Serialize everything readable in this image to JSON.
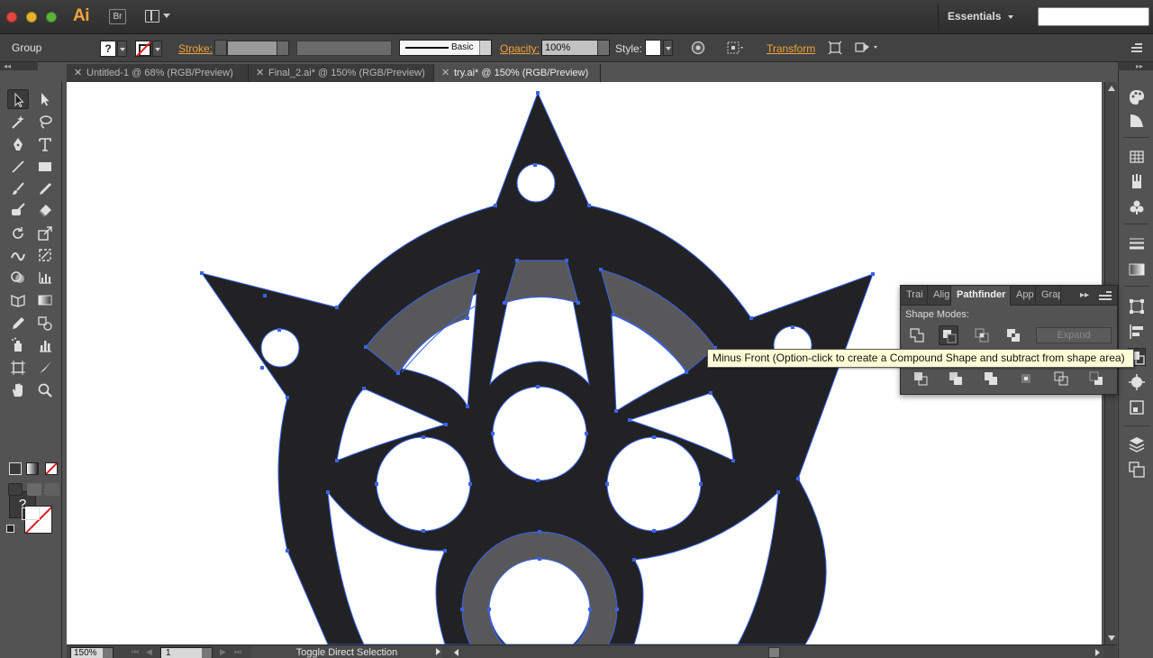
{
  "app": {
    "logo": "Ai",
    "bridge_label": "Br",
    "workspace": "Essentials",
    "search_placeholder": ""
  },
  "control_bar": {
    "selection_type": "Group",
    "fill_label": "?",
    "stroke_label": "Stroke:",
    "stroke_weight": "",
    "brush_definition": "Basic",
    "opacity_label": "Opacity:",
    "opacity_value": "100%",
    "style_label": "Style:",
    "transform_label": "Transform"
  },
  "tabs": [
    {
      "label": "Untitled-1 @ 68% (RGB/Preview)",
      "active": false
    },
    {
      "label": "Final_2.ai* @ 150% (RGB/Preview)",
      "active": false
    },
    {
      "label": "try.ai* @ 150% (RGB/Preview)",
      "active": true
    }
  ],
  "tools_panel": {
    "fill_indicator": "?"
  },
  "pathfinder": {
    "tabs": [
      "Trai",
      "Alig",
      "Pathfinder",
      "App",
      "Grap"
    ],
    "active_tab": "Pathfinder",
    "shape_modes_label": "Shape Modes:",
    "expand_label": "Expand",
    "shape_modes": [
      "unite",
      "minus-front",
      "intersect",
      "exclude"
    ],
    "pathfinders": [
      "divide",
      "trim",
      "merge",
      "crop",
      "outline",
      "minus-back"
    ]
  },
  "tooltip": {
    "text": "Minus Front (Option-click to create a Compound Shape and subtract from shape area)"
  },
  "status_bar": {
    "zoom": "150%",
    "page": "1",
    "info": "Toggle Direct Selection"
  },
  "colors": {
    "accent_link": "#f2a33a",
    "artwork_fill": "#222224",
    "artwork_highlight": "#58585a",
    "selection_path": "#3b63e8",
    "tooltip_bg": "#fffed6"
  }
}
